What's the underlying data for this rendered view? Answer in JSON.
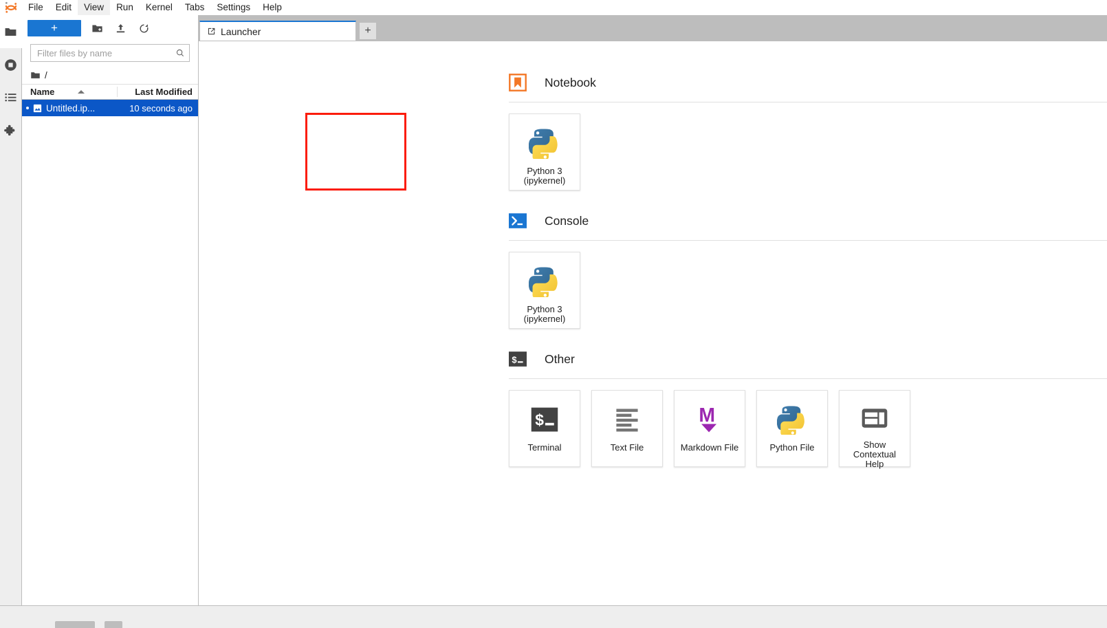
{
  "app": {
    "name": "JupyterLab",
    "logo_icon": "jupyter-logo-icon"
  },
  "menubar": {
    "items": [
      {
        "label": "File",
        "active": false
      },
      {
        "label": "Edit",
        "active": false
      },
      {
        "label": "View",
        "active": true
      },
      {
        "label": "Run",
        "active": false
      },
      {
        "label": "Kernel",
        "active": false
      },
      {
        "label": "Tabs",
        "active": false
      },
      {
        "label": "Settings",
        "active": false
      },
      {
        "label": "Help",
        "active": false
      }
    ]
  },
  "activitybar": {
    "items": [
      {
        "name": "file-browser",
        "icon": "folder-icon",
        "selected": true
      },
      {
        "name": "running-sessions",
        "icon": "stop-circle-icon",
        "selected": false
      },
      {
        "name": "commands",
        "icon": "list-icon",
        "selected": false
      },
      {
        "name": "extension-manager",
        "icon": "puzzle-piece-icon",
        "selected": false
      }
    ]
  },
  "filebrowser": {
    "toolbar": {
      "new_launcher_label": "+",
      "new_folder_icon": "new-folder-icon",
      "upload_icon": "upload-icon",
      "refresh_icon": "refresh-icon"
    },
    "filter": {
      "placeholder": "Filter files by name",
      "value": "",
      "icon": "search-icon"
    },
    "breadcrumb": {
      "root_icon": "folder-icon",
      "path": "/"
    },
    "columns": {
      "name": "Name",
      "last_modified": "Last Modified",
      "sort_direction": "ascending"
    },
    "files": [
      {
        "name": "Untitled.ip...",
        "full_name": "Untitled.ipynb",
        "last_modified": "10 seconds ago",
        "icon": "notebook-icon",
        "selected": true,
        "unsaved": true
      }
    ]
  },
  "tabbar": {
    "tabs": [
      {
        "label": "Launcher",
        "icon": "launcher-icon",
        "active": true
      }
    ],
    "add_tab_label": "+"
  },
  "launcher": {
    "sections": [
      {
        "id": "notebook",
        "title": "Notebook",
        "icon": "notebook-section-icon",
        "icon_color": "#f37726",
        "cards": [
          {
            "label": "Python 3\n(ipykernel)",
            "label_line1": "Python 3",
            "label_line2": "(ipykernel)",
            "icon": "python-logo-icon",
            "highlighted": true
          }
        ]
      },
      {
        "id": "console",
        "title": "Console",
        "icon": "console-section-icon",
        "icon_color": "#1a76d2",
        "cards": [
          {
            "label": "Python 3\n(ipykernel)",
            "label_line1": "Python 3",
            "label_line2": "(ipykernel)",
            "icon": "python-logo-icon",
            "highlighted": false
          }
        ]
      },
      {
        "id": "other",
        "title": "Other",
        "icon": "other-section-icon",
        "icon_color": "#424242",
        "cards": [
          {
            "label": "Terminal",
            "label_line1": "Terminal",
            "label_line2": "",
            "icon": "terminal-icon",
            "highlighted": false
          },
          {
            "label": "Text File",
            "label_line1": "Text File",
            "label_line2": "",
            "icon": "text-file-icon",
            "highlighted": false
          },
          {
            "label": "Markdown File",
            "label_line1": "Markdown File",
            "label_line2": "",
            "icon": "markdown-icon",
            "highlighted": false
          },
          {
            "label": "Python File",
            "label_line1": "Python File",
            "label_line2": "",
            "icon": "python-logo-icon",
            "highlighted": false
          },
          {
            "label": "Show Contextual Help",
            "label_line1": "Show",
            "label_line2": "Contextual",
            "label_line3": "Help",
            "icon": "contextual-help-icon",
            "highlighted": false
          }
        ]
      }
    ]
  },
  "annotation": {
    "highlight_color": "#fb1c0b",
    "target": "Python 3 (ipykernel) notebook card"
  },
  "colors": {
    "accent_blue": "#1a76d2",
    "selection_blue": "#0b57c7",
    "jupyter_orange": "#f37726",
    "python_blue": "#386d9e",
    "python_yellow": "#f5ca3c",
    "markdown_purple": "#9c27b0",
    "chrome_gray": "#bdbdbd",
    "panel_gray": "#eeeeee"
  }
}
